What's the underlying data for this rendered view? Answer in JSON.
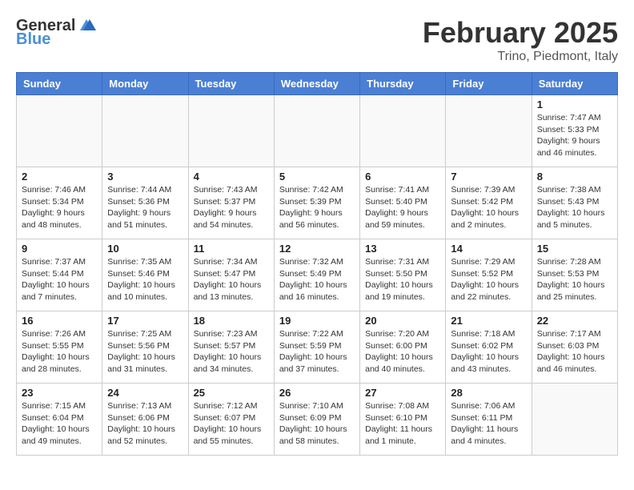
{
  "header": {
    "logo_general": "General",
    "logo_blue": "Blue",
    "month": "February 2025",
    "location": "Trino, Piedmont, Italy"
  },
  "weekdays": [
    "Sunday",
    "Monday",
    "Tuesday",
    "Wednesday",
    "Thursday",
    "Friday",
    "Saturday"
  ],
  "weeks": [
    [
      {
        "day": "",
        "info": ""
      },
      {
        "day": "",
        "info": ""
      },
      {
        "day": "",
        "info": ""
      },
      {
        "day": "",
        "info": ""
      },
      {
        "day": "",
        "info": ""
      },
      {
        "day": "",
        "info": ""
      },
      {
        "day": "1",
        "info": "Sunrise: 7:47 AM\nSunset: 5:33 PM\nDaylight: 9 hours and 46 minutes."
      }
    ],
    [
      {
        "day": "2",
        "info": "Sunrise: 7:46 AM\nSunset: 5:34 PM\nDaylight: 9 hours and 48 minutes."
      },
      {
        "day": "3",
        "info": "Sunrise: 7:44 AM\nSunset: 5:36 PM\nDaylight: 9 hours and 51 minutes."
      },
      {
        "day": "4",
        "info": "Sunrise: 7:43 AM\nSunset: 5:37 PM\nDaylight: 9 hours and 54 minutes."
      },
      {
        "day": "5",
        "info": "Sunrise: 7:42 AM\nSunset: 5:39 PM\nDaylight: 9 hours and 56 minutes."
      },
      {
        "day": "6",
        "info": "Sunrise: 7:41 AM\nSunset: 5:40 PM\nDaylight: 9 hours and 59 minutes."
      },
      {
        "day": "7",
        "info": "Sunrise: 7:39 AM\nSunset: 5:42 PM\nDaylight: 10 hours and 2 minutes."
      },
      {
        "day": "8",
        "info": "Sunrise: 7:38 AM\nSunset: 5:43 PM\nDaylight: 10 hours and 5 minutes."
      }
    ],
    [
      {
        "day": "9",
        "info": "Sunrise: 7:37 AM\nSunset: 5:44 PM\nDaylight: 10 hours and 7 minutes."
      },
      {
        "day": "10",
        "info": "Sunrise: 7:35 AM\nSunset: 5:46 PM\nDaylight: 10 hours and 10 minutes."
      },
      {
        "day": "11",
        "info": "Sunrise: 7:34 AM\nSunset: 5:47 PM\nDaylight: 10 hours and 13 minutes."
      },
      {
        "day": "12",
        "info": "Sunrise: 7:32 AM\nSunset: 5:49 PM\nDaylight: 10 hours and 16 minutes."
      },
      {
        "day": "13",
        "info": "Sunrise: 7:31 AM\nSunset: 5:50 PM\nDaylight: 10 hours and 19 minutes."
      },
      {
        "day": "14",
        "info": "Sunrise: 7:29 AM\nSunset: 5:52 PM\nDaylight: 10 hours and 22 minutes."
      },
      {
        "day": "15",
        "info": "Sunrise: 7:28 AM\nSunset: 5:53 PM\nDaylight: 10 hours and 25 minutes."
      }
    ],
    [
      {
        "day": "16",
        "info": "Sunrise: 7:26 AM\nSunset: 5:55 PM\nDaylight: 10 hours and 28 minutes."
      },
      {
        "day": "17",
        "info": "Sunrise: 7:25 AM\nSunset: 5:56 PM\nDaylight: 10 hours and 31 minutes."
      },
      {
        "day": "18",
        "info": "Sunrise: 7:23 AM\nSunset: 5:57 PM\nDaylight: 10 hours and 34 minutes."
      },
      {
        "day": "19",
        "info": "Sunrise: 7:22 AM\nSunset: 5:59 PM\nDaylight: 10 hours and 37 minutes."
      },
      {
        "day": "20",
        "info": "Sunrise: 7:20 AM\nSunset: 6:00 PM\nDaylight: 10 hours and 40 minutes."
      },
      {
        "day": "21",
        "info": "Sunrise: 7:18 AM\nSunset: 6:02 PM\nDaylight: 10 hours and 43 minutes."
      },
      {
        "day": "22",
        "info": "Sunrise: 7:17 AM\nSunset: 6:03 PM\nDaylight: 10 hours and 46 minutes."
      }
    ],
    [
      {
        "day": "23",
        "info": "Sunrise: 7:15 AM\nSunset: 6:04 PM\nDaylight: 10 hours and 49 minutes."
      },
      {
        "day": "24",
        "info": "Sunrise: 7:13 AM\nSunset: 6:06 PM\nDaylight: 10 hours and 52 minutes."
      },
      {
        "day": "25",
        "info": "Sunrise: 7:12 AM\nSunset: 6:07 PM\nDaylight: 10 hours and 55 minutes."
      },
      {
        "day": "26",
        "info": "Sunrise: 7:10 AM\nSunset: 6:09 PM\nDaylight: 10 hours and 58 minutes."
      },
      {
        "day": "27",
        "info": "Sunrise: 7:08 AM\nSunset: 6:10 PM\nDaylight: 11 hours and 1 minute."
      },
      {
        "day": "28",
        "info": "Sunrise: 7:06 AM\nSunset: 6:11 PM\nDaylight: 11 hours and 4 minutes."
      },
      {
        "day": "",
        "info": ""
      }
    ]
  ]
}
